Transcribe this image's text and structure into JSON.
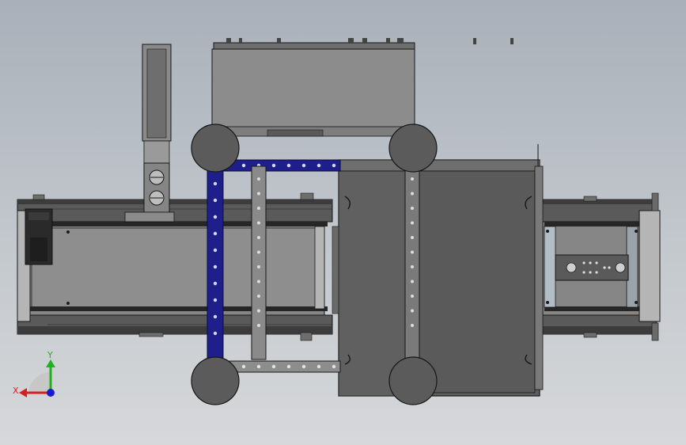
{
  "viewport": {
    "background_top": "#a9b0b9",
    "background_bottom": "#d6d8da"
  },
  "colors": {
    "steel_light": "#9a9a9a",
    "steel_mid": "#7a7a7a",
    "steel_dark": "#5e5e5e",
    "outline": "#161616",
    "belt_black": "#262626",
    "belt_frame": "#b5b5b5",
    "blue_bracket": "#1f1f8c",
    "wheel": "#5b5b5b",
    "panel_grey": "#888888"
  },
  "triad": {
    "x_label": "X",
    "y_label": "Y",
    "x_color": "#d42020",
    "y_color": "#20b020",
    "z_color": "#1a1ad0"
  },
  "parts": [
    "left-conveyor",
    "right-conveyor",
    "motor-housing",
    "upright-bracket",
    "top-cover-plate",
    "center-box",
    "vertical-rails",
    "blue-bracket",
    "cross-bars",
    "caster-wheels",
    "control-panel"
  ]
}
